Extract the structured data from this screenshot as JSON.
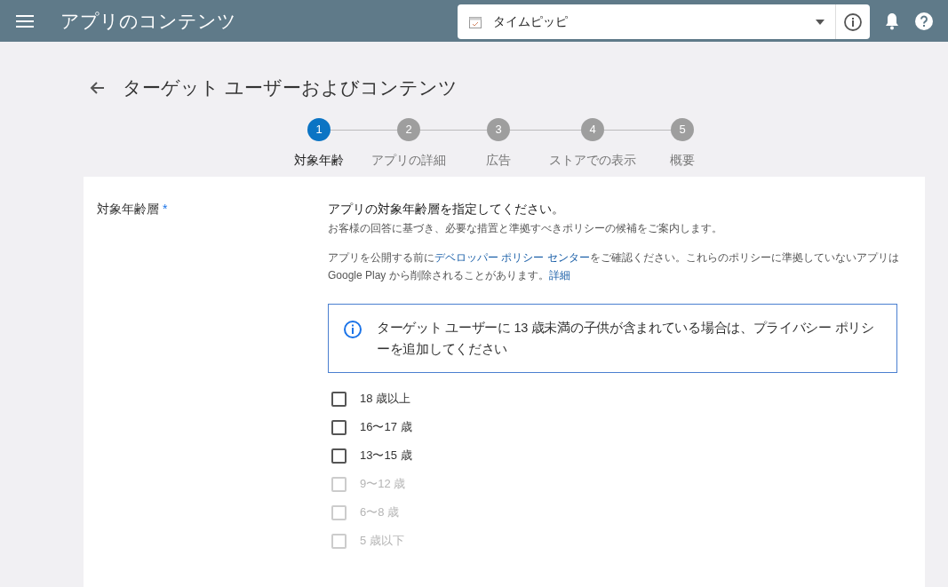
{
  "header": {
    "title": "アプリのコンテンツ",
    "app_selector": {
      "value": "タイムピッピ"
    }
  },
  "page_title": "ターゲット ユーザーおよびコンテンツ",
  "steps": [
    {
      "number": "1",
      "label": "対象年齢",
      "selected": true
    },
    {
      "number": "2",
      "label": "アプリの詳細",
      "selected": false
    },
    {
      "number": "3",
      "label": "広告",
      "selected": false
    },
    {
      "number": "4",
      "label": "ストアでの表示",
      "selected": false
    },
    {
      "number": "5",
      "label": "概要",
      "selected": false
    }
  ],
  "section": {
    "label": "対象年齢層",
    "required_mark": "*",
    "heading": "アプリの対象年齢層を指定してください。",
    "subheading": "お客様の回答に基づき、必要な措置と準拠すべきポリシーの候補をご案内します。",
    "policy_note": [
      {
        "kind": "text",
        "text": "アプリを公開する前に"
      },
      {
        "kind": "link",
        "text": "デベロッパー ポリシー センター"
      },
      {
        "kind": "text",
        "text": "をご確認ください。これらのポリシーに準拠していないアプリは Google Play から削除されることがあります。"
      },
      {
        "kind": "link",
        "text": "詳細"
      }
    ],
    "info_box": "ターゲット ユーザーに 13 歳未満の子供が含まれている場合は、プライバシー ポリシーを追加してください",
    "age_options": [
      {
        "label": "18 歳以上",
        "checked": false,
        "disabled": false
      },
      {
        "label": "16〜17 歳",
        "checked": false,
        "disabled": false
      },
      {
        "label": "13〜15 歳",
        "checked": false,
        "disabled": false
      },
      {
        "label": "9〜12 歳",
        "checked": false,
        "disabled": true
      },
      {
        "label": "6〜8 歳",
        "checked": false,
        "disabled": true
      },
      {
        "label": "5 歳以下",
        "checked": false,
        "disabled": true
      }
    ]
  }
}
